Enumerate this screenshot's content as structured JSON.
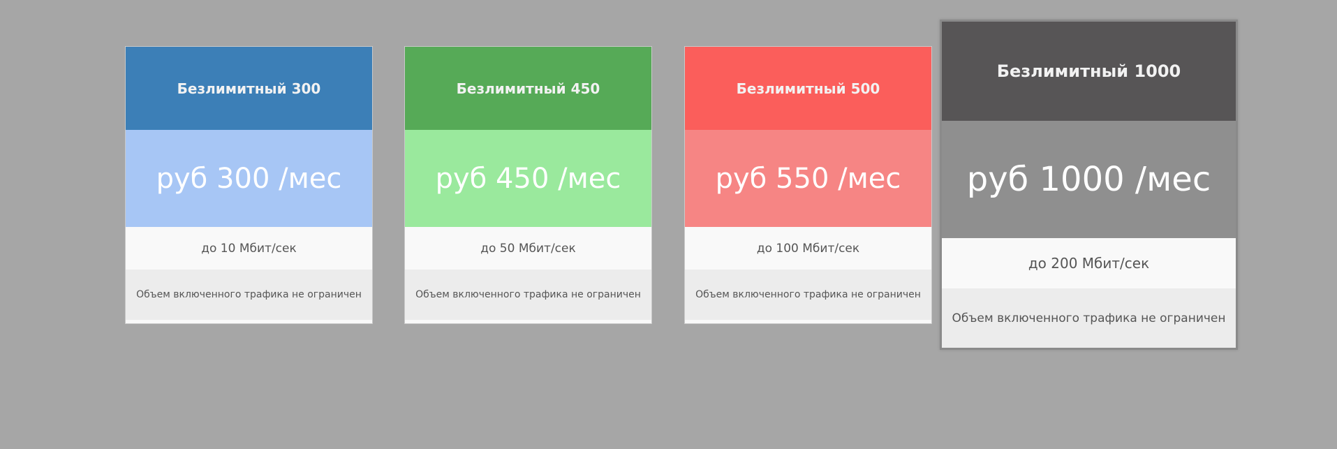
{
  "colors": {
    "page_background": "#a6a6a6",
    "card_background": "#ffffff",
    "speed_row": "#f9f9f9",
    "traffic_row": "#ececec",
    "row_text": "#555555"
  },
  "plans": [
    {
      "name": "Безлимитный 300",
      "price": "руб 300 /мес",
      "speed": "до 10 Мбит/сек",
      "traffic": "Объем включенного трафика не ограничен",
      "header_color": "#3c7fb7",
      "price_color": "#a7c6f5",
      "featured": false
    },
    {
      "name": "Безлимитный 450",
      "price": "руб 450 /мес",
      "speed": "до 50 Мбит/сек",
      "traffic": "Объем включенного трафика не ограничен",
      "header_color": "#56aa57",
      "price_color": "#9ae99d",
      "featured": false
    },
    {
      "name": "Безлимитный 500",
      "price": "руб 550 /мес",
      "speed": "до 100 Мбит/сек",
      "traffic": "Объем включенного трафика не ограничен",
      "header_color": "#fb5e5b",
      "price_color": "#f68584",
      "featured": false
    },
    {
      "name": "Безлимитный 1000",
      "price": "руб 1000 /мес",
      "speed": "до 200 Мбит/сек",
      "traffic": "Объем включенного трафика не ограничен",
      "header_color": "#575556",
      "price_color": "#8f8f8f",
      "featured": true
    }
  ]
}
